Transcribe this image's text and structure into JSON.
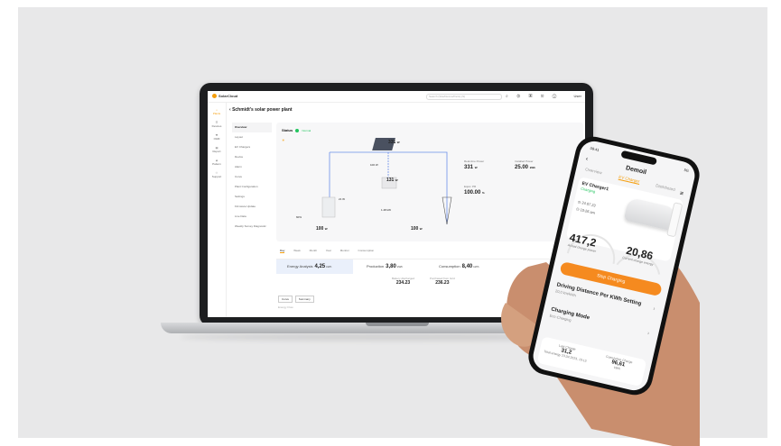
{
  "laptop": {
    "brand": "SolarCloud",
    "search_placeholder": "Search (Site/Device/Parts) (S)",
    "user": "User",
    "nav": [
      {
        "label": "Plants",
        "active": true
      },
      {
        "label": "Devices"
      },
      {
        "label": "O&M"
      },
      {
        "label": "Report"
      },
      {
        "label": "Pattern"
      },
      {
        "label": "Support"
      }
    ],
    "breadcrumb": "Schmidt's solar power plant",
    "submenu": [
      "Overview",
      "Layout",
      "EV Chargers",
      "Device",
      "Alarm",
      "Curve",
      "Plant Configuration",
      "Settings",
      "Firmware Update",
      "Live Data",
      "Weekly Survey Diagnostic"
    ],
    "status_label": "Status",
    "status_value": "Normal",
    "flow": {
      "battery_pct": "60%",
      "pv": "331",
      "pv_unit": "W",
      "inverter": "131",
      "inverter_unit": "W",
      "ev": "21 W",
      "home_load": "100 W",
      "battery": "100",
      "grid": "100",
      "unit": "W",
      "grid_small": "1.48 kW",
      "top_small": "100 W"
    },
    "kpis": [
      {
        "label": "Real-time Power",
        "value": "331",
        "unit": "W"
      },
      {
        "label": "Installed Power",
        "value": "25.00",
        "unit": "kWh"
      },
      {
        "label": "Equiv. PR",
        "value": "100.00",
        "unit": "%"
      }
    ],
    "tabs": [
      "Day",
      "Week",
      "Month",
      "Year",
      "Monitor",
      "Consumption"
    ],
    "energy": [
      {
        "label": "Energy Analysis",
        "value": "4,25",
        "unit": "kWh"
      },
      {
        "label": "Production",
        "value": "3,80",
        "unit": "kWh"
      },
      {
        "label": "Consumption",
        "value": "8,40",
        "unit": "kWh"
      }
    ],
    "small_stats": [
      {
        "label": "Battery discharged",
        "value": "234.23"
      },
      {
        "label": "Purchased from Grid",
        "value": "236.23"
      }
    ],
    "buttons": [
      "Curve",
      "Summary"
    ],
    "footer_label": "Energy Flow"
  },
  "phone": {
    "time": "09:41",
    "signal": "5G",
    "title": "Demoil",
    "tabs": [
      "Overview",
      "EV Charger",
      "Dashboard"
    ],
    "active_tab": "EV Charger",
    "charger_name": "EV Charger1",
    "charger_status": "Charging",
    "date": "24.07.23",
    "time_started": "10:26 am",
    "charge_power": "417,2",
    "charge_power_label": "Actual charge power",
    "current_value": "20,86",
    "current_label": "Current charge energy",
    "cta": "Stop Charging",
    "rows": [
      {
        "title": "Driving Distance Per KWh Setting",
        "sub": "20,0 km/kWh"
      },
      {
        "title": "Charging Mode",
        "sub": "Eco-Charging"
      }
    ],
    "bottom": [
      {
        "label": "Last Charge",
        "value": "31,2",
        "sub": "Total energy 23,04.2023, 10:13"
      },
      {
        "label": "Cumulative Charge",
        "value": "96,61",
        "sub": "kWh"
      }
    ]
  }
}
